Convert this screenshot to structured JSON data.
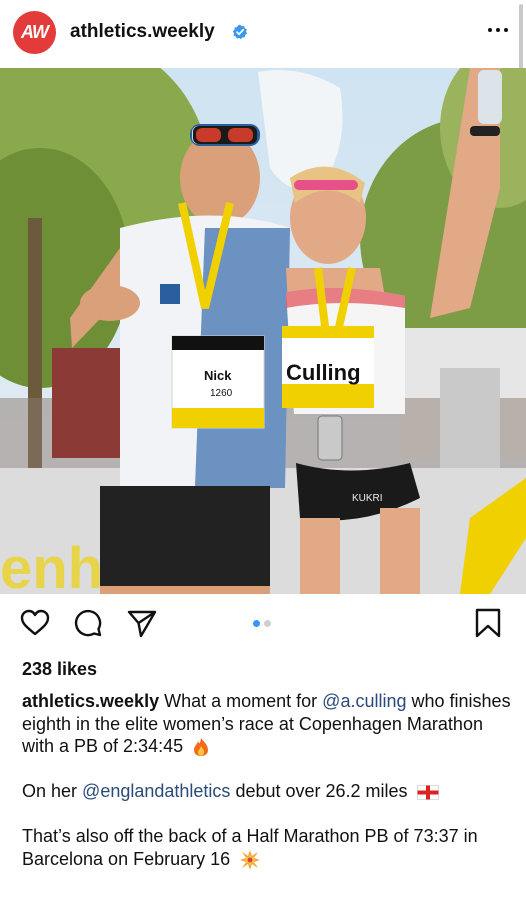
{
  "header": {
    "avatar_text": "AW",
    "username": "athletics.weekly",
    "verified_icon": "verified-badge-icon",
    "more_icon": "more-options-icon"
  },
  "post": {
    "image_alt": "Two runners celebrating with medals after the Copenhagen Marathon",
    "bib_left_name": "Nick",
    "bib_left_number": "1260",
    "bib_right_name": "Culling",
    "shorts_brand": "KUKRI",
    "banner_text": "enhagen",
    "carousel_count": 2,
    "carousel_active": 0
  },
  "actions": {
    "like_icon": "heart-icon",
    "comment_icon": "comment-icon",
    "share_icon": "send-icon",
    "save_icon": "bookmark-icon"
  },
  "likes": "238 likes",
  "caption": {
    "author": "athletics.weekly",
    "line1_pre": "What a moment for",
    "mention1": "@a.culling",
    "line1_post": "who finishes eighth in the elite women’s race at Copenhagen Marathon with a PB of 2:34:45",
    "line2_pre": "On her",
    "mention2": "@englandathletics",
    "line2_post": "debut over 26.2 miles",
    "line3": "That’s also off the back of a Half Marathon PB of 73:37 in Barcelona on February 16"
  },
  "colors": {
    "avatar_red": "#e33a3a",
    "verified_blue": "#3897f0",
    "mention": "#2a4a7a",
    "dot_active": "#3897f0"
  }
}
